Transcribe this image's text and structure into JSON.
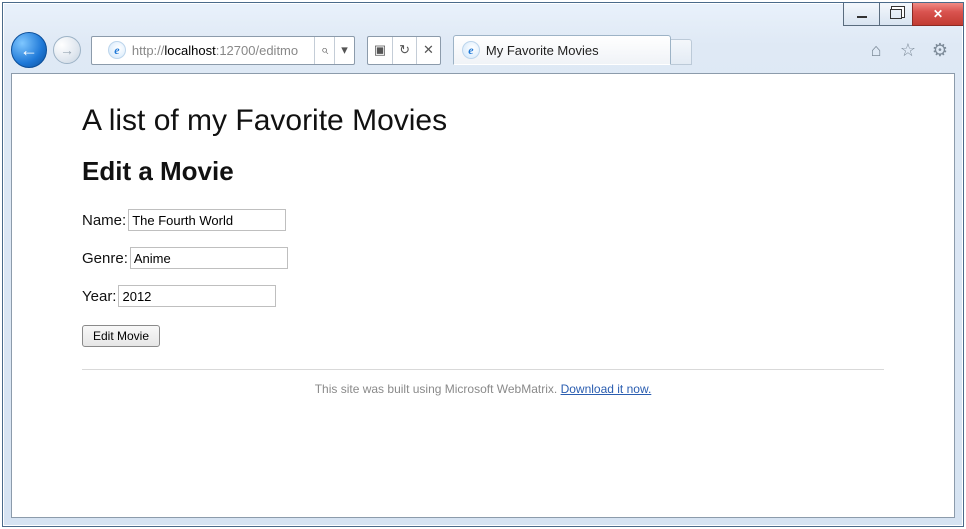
{
  "window": {
    "caption_min": "Minimize",
    "caption_max": "Restore",
    "caption_close": "Close"
  },
  "browser": {
    "back_glyph": "←",
    "fwd_glyph": "→",
    "url_host": "localhost",
    "url_port": ":12700",
    "url_path": "/editmo",
    "search_glyph": "⌕",
    "dropdown_glyph": "▾",
    "compat_glyph": "▣",
    "refresh_glyph": "↻",
    "stop_glyph": "✕",
    "tab_title": "My Favorite Movies",
    "home_glyph": "⌂",
    "star_glyph": "☆",
    "gear_glyph": "⚙"
  },
  "page": {
    "site_title": "A list of my Favorite Movies",
    "heading": "Edit a Movie",
    "fields": {
      "name_label": "Name:",
      "name_value": "The Fourth World",
      "genre_label": "Genre:",
      "genre_value": "Anime",
      "year_label": "Year:",
      "year_value": "2012"
    },
    "submit_label": "Edit Movie",
    "footer_text": "This site was built using Microsoft WebMatrix. ",
    "footer_link": "Download it now."
  }
}
